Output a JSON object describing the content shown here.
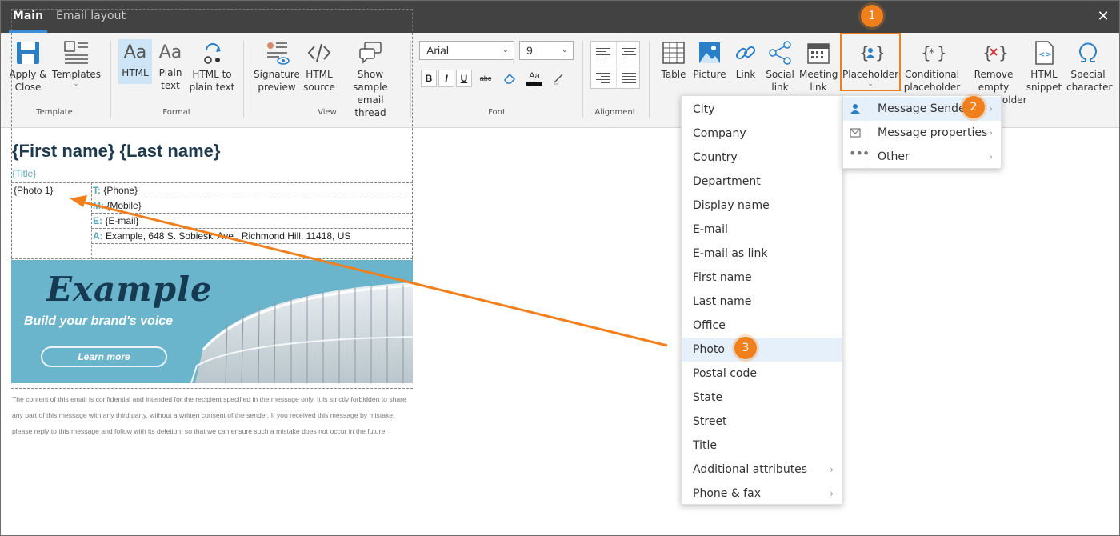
{
  "tabs": [
    {
      "label": "Main",
      "active": true
    },
    {
      "label": "Email layout",
      "active": false
    }
  ],
  "close_symbol": "✕",
  "ribbon": {
    "template": {
      "label": "Template",
      "apply_close": [
        "Apply &",
        "Close"
      ],
      "templates": "Templates"
    },
    "format": {
      "label": "Format",
      "html": "HTML",
      "plain_text": [
        "Plain",
        "text"
      ],
      "html_to_plain": [
        "HTML to",
        "plain text"
      ],
      "aa": "Aa"
    },
    "view": {
      "label": "View",
      "signature_preview": [
        "Signature",
        "preview"
      ],
      "html_source": [
        "HTML",
        "source"
      ],
      "sample_thread": [
        "Show sample",
        "email thread"
      ]
    },
    "font": {
      "label": "Font",
      "family": "Arial",
      "size": "9",
      "bold": "B",
      "italic": "I",
      "underline": "U",
      "strike": "abc",
      "highlight_aa": "Aa"
    },
    "alignment": {
      "label": "Alignment"
    },
    "insert": {
      "table": "Table",
      "picture": "Picture",
      "link": "Link",
      "social_link": [
        "Social",
        "link"
      ],
      "meeting_link": [
        "Meeting",
        "link"
      ],
      "placeholder": "Placeholder",
      "conditional_placeholder": [
        "Conditional",
        "placeholder"
      ],
      "remove_empty": [
        "Remove",
        "empty",
        "placeholder"
      ],
      "html_snippet": [
        "HTML",
        "snippet"
      ],
      "special_character": [
        "Special",
        "character"
      ]
    }
  },
  "badges": [
    "1",
    "2",
    "3"
  ],
  "accent_color": "#f07f1c",
  "signature": {
    "name": "{First name} {Last name}",
    "title": "{Title}",
    "photo": "{Photo 1}",
    "fields": [
      {
        "key": "T:",
        "value": "{Phone}"
      },
      {
        "key": "M:",
        "value": "{Mobile}"
      },
      {
        "key": "E:",
        "value": "{E-mail}"
      },
      {
        "key": "A:",
        "value": "Example, 648 S. Sobieski Ave., Richmond Hill, 11418, US"
      }
    ],
    "banner": {
      "brand": "Example",
      "tagline": "Build your brand's voice",
      "button": "Learn more"
    },
    "disclaimer": "The content of this email is confidential and intended for the recipient specified in the message only. It is strictly forbidden to share any part of this message with any third party, without a written consent of the sender. If you received this message by mistake, please reply to this message and follow with its deletion, so that we can ensure such a mistake does not occur in the future."
  },
  "placeholder_menu": [
    {
      "label": "Message Sender",
      "icon": "person-icon",
      "active": true
    },
    {
      "label": "Message properties",
      "icon": "envelope-icon"
    },
    {
      "label": "Other",
      "icon": "more-icon"
    }
  ],
  "sender_submenu": [
    "City",
    "Company",
    "Country",
    "Department",
    "Display name",
    "E-mail",
    "E-mail as link",
    "First name",
    "Last name",
    "Office",
    "Photo",
    "Postal code",
    "State",
    "Street",
    "Title",
    "Additional attributes",
    "Phone & fax"
  ],
  "chevron": "›"
}
